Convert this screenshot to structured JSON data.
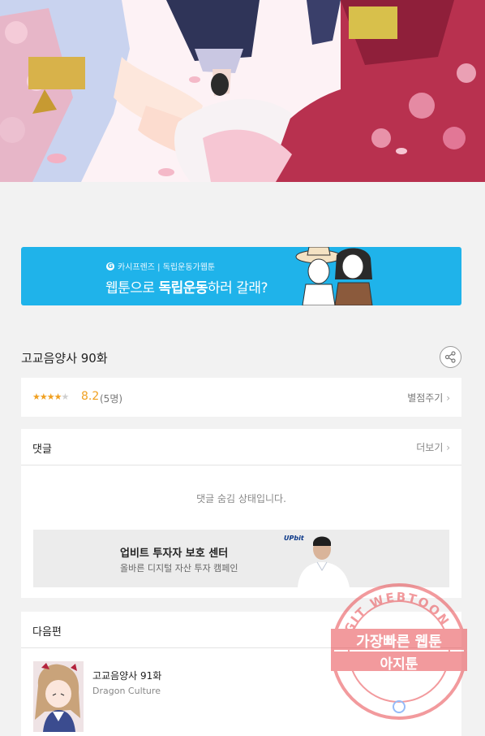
{
  "banner": {
    "brand": "카시프렌즈 | 독립운동가웹툰",
    "headline_prefix": "웹툰으로 ",
    "headline_bold": "독립운동",
    "headline_suffix": "하러 갈래?"
  },
  "episode": {
    "title": "고교음양사 90화",
    "rating_stars": 4,
    "rating_max": 5,
    "score": "8.2",
    "rating_count": "(5명)",
    "rate_label": "별점주기"
  },
  "comments": {
    "label": "댓글",
    "more_label": "더보기",
    "hidden_message": "댓글 숨김 상태입니다."
  },
  "ad": {
    "brand": "UPbit",
    "title": "업비트 투자자 보호 센터",
    "subtitle": "올바른 디지털 자산 투자 캠페인"
  },
  "next": {
    "label": "다음편",
    "item_title": "고교음양사 91화",
    "item_author": "Dragon Culture"
  },
  "watermark": {
    "ring_text": "AGIT WEBTOON",
    "line1": "가장빠른 웹툰",
    "line2": "아지툰"
  },
  "colors": {
    "banner": "#1fb3ea",
    "star": "#f0a020",
    "watermark": "#e8484e"
  }
}
